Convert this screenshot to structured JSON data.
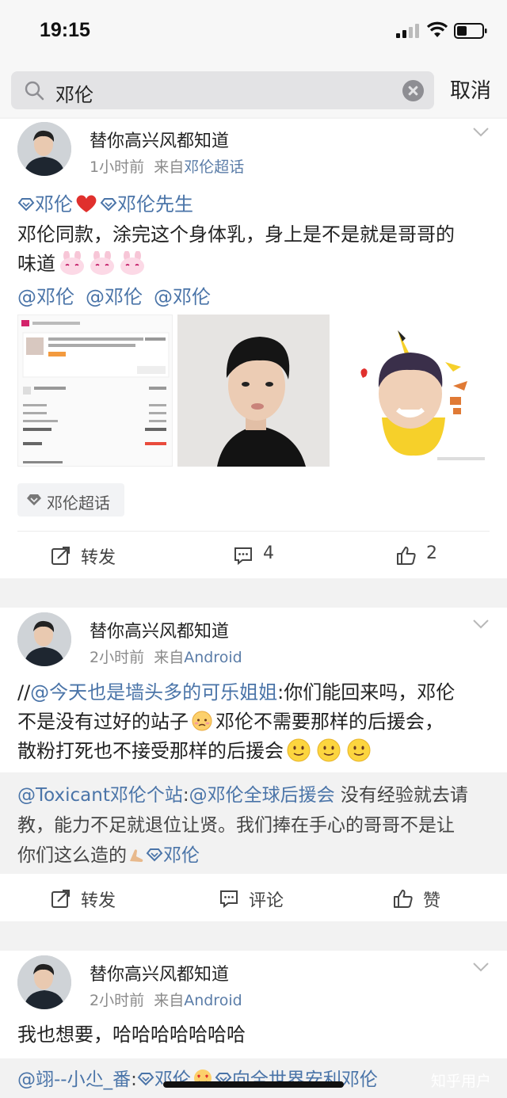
{
  "status": {
    "time": "19:15"
  },
  "search": {
    "query": "邓伦",
    "cancel": "取消"
  },
  "posts": [
    {
      "author": "替你高兴风都知道",
      "time": "1小时前",
      "from_prefix": "来自",
      "source": "邓伦超话",
      "tag1": "邓伦",
      "tag2": "邓伦先生",
      "text_line1": "邓伦同款，涂完这个身体乳，身上是不是就是哥哥的",
      "text_line2": "味道",
      "mentions": [
        "@邓伦",
        "@邓伦",
        "@邓伦"
      ],
      "chip": "邓伦超话",
      "actions": {
        "repost": "转发",
        "comment_count": "4",
        "like_count": "2"
      }
    },
    {
      "author": "替你高兴风都知道",
      "time": "2小时前",
      "from_prefix": "来自",
      "source": "Android",
      "text_a_prefix": "//",
      "text_a_link": "@今天也是墙头多的可乐姐姐",
      "text_a_rest": ":你们能回来吗，邓伦",
      "text_b": "不是没有过好的站子",
      "text_b2": "邓伦不需要那样的后援会，",
      "text_c": "散粉打死也不接受那样的后援会",
      "repost_link1": "@Toxicant邓伦个站",
      "repost_colon": ":",
      "repost_link2": "@邓伦全球后援会",
      "repost_rest1": " 没有经验就去请",
      "repost_line2": "教，能力不足就退位让贤。我们捧在手心的哥哥不是让",
      "repost_line3": "你们这么造的",
      "repost_tag": "邓伦",
      "actions": {
        "repost": "转发",
        "comment": "评论",
        "like": "赞"
      }
    },
    {
      "author": "替你高兴风都知道",
      "time": "2小时前",
      "from_prefix": "来自",
      "source": "Android",
      "text": "我也想要，哈哈哈哈哈哈哈",
      "repost_link": "@翊--小尐_番",
      "repost_colon": ":",
      "repost_tag1": "邓伦",
      "repost_tag2": "向全世界安利邓伦"
    }
  ],
  "watermark": "知乎用户",
  "colors": {
    "link": "#4a74a8",
    "heart": "#e0302d",
    "background": "#f2f2f2"
  }
}
